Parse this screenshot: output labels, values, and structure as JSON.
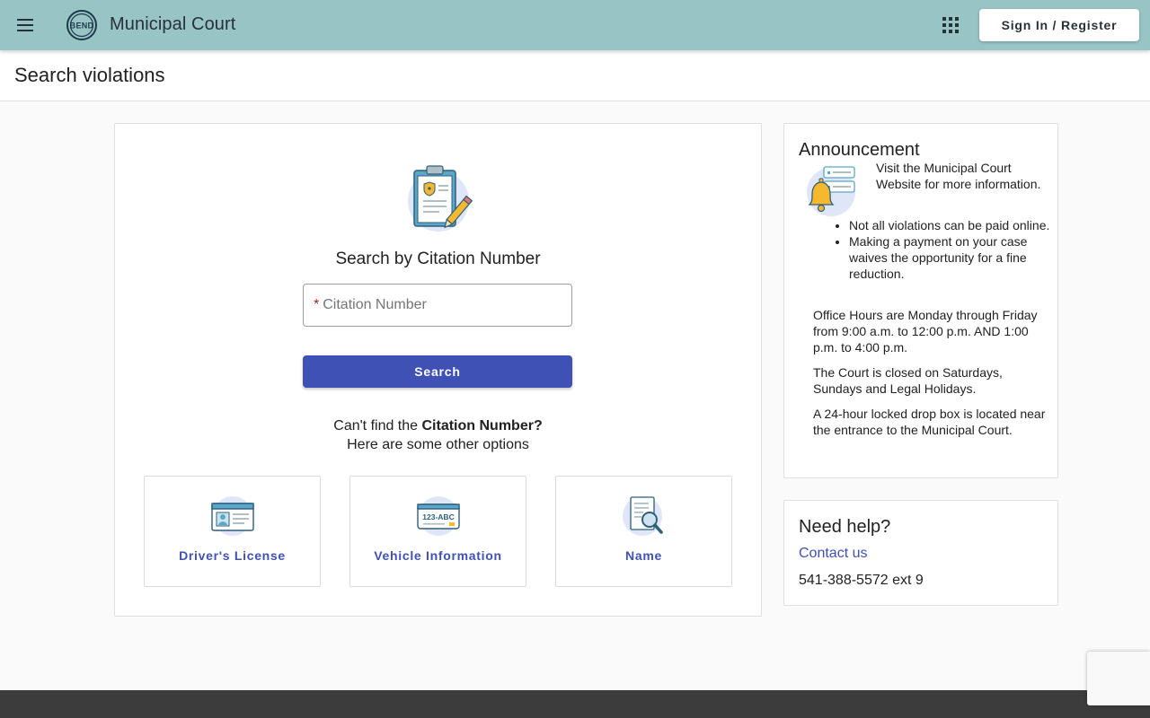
{
  "header": {
    "app_title": "Municipal Court",
    "signin_label": "Sign In / Register",
    "logo_text": "BEND",
    "color": "#98c4c6"
  },
  "page": {
    "title": "Search violations"
  },
  "search": {
    "heading": "Search by Citation Number",
    "required_mark": "*",
    "placeholder": "Citation Number",
    "button_label": "Search",
    "cant_find_prefix": "Can't find the ",
    "cant_find_bold": "Citation Number?",
    "other_options": "Here are some other options",
    "accent": "#3f51b5"
  },
  "options": [
    {
      "label": "Driver's License",
      "icon": "id-card-icon"
    },
    {
      "label": "Vehicle Information",
      "icon": "license-plate-icon"
    },
    {
      "label": "Name",
      "icon": "document-search-icon"
    }
  ],
  "plate_text": "123-ABC",
  "announcement": {
    "title": "Announcement",
    "visit": "Visit the Municipal Court Website for more information.",
    "bullets": [
      "Not all violations can be paid online.",
      "Making a payment on your case waives the opportunity for a fine reduction."
    ],
    "hours": "Office Hours are Monday through Friday from 9:00 a.m. to 12:00 p.m. AND 1:00 p.m. to 4:00 p.m.",
    "closed": "The Court is closed on Saturdays, Sundays and Legal Holidays.",
    "dropbox": "A 24-hour locked drop box is located near the entrance to the Municipal Court."
  },
  "help": {
    "title": "Need help?",
    "contact_label": "Contact us",
    "phone": "541-388-5572 ext 9"
  }
}
